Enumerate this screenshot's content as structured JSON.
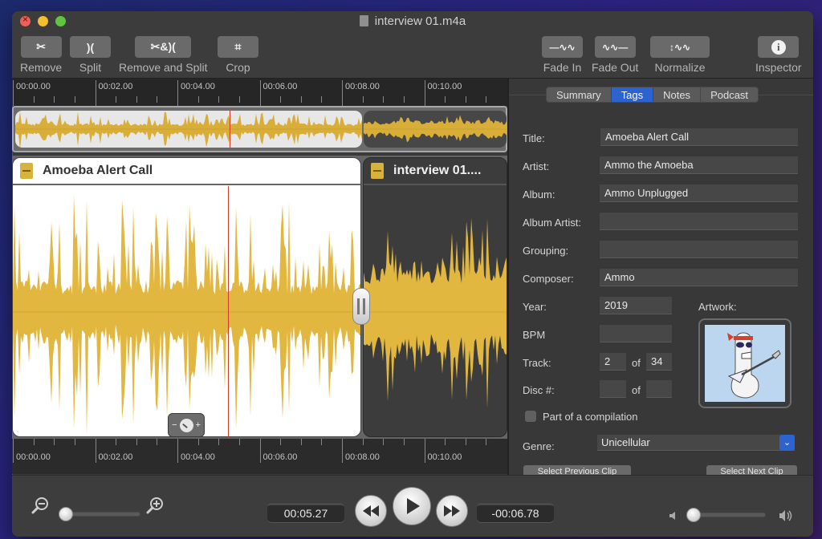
{
  "window": {
    "title": "interview 01.m4a"
  },
  "toolbar": {
    "left": [
      {
        "id": "remove",
        "label": "Remove",
        "icon": "scissors-icon",
        "glyph": "✂"
      },
      {
        "id": "split",
        "label": "Split",
        "icon": "split-icon",
        "glyph": ")("
      },
      {
        "id": "remove-and-split",
        "label": "Remove and Split",
        "icon": "remove-and-split-icon",
        "glyph": "✂&)("
      },
      {
        "id": "crop",
        "label": "Crop",
        "icon": "crop-icon",
        "glyph": "⌗"
      }
    ],
    "right": [
      {
        "id": "fade-in",
        "label": "Fade In",
        "icon": "fade-in-icon",
        "glyph": "—∿∿"
      },
      {
        "id": "fade-out",
        "label": "Fade Out",
        "icon": "fade-out-icon",
        "glyph": "∿∿—"
      },
      {
        "id": "normalize",
        "label": "Normalize",
        "icon": "normalize-icon",
        "glyph": "↕∿∿"
      },
      {
        "id": "inspector",
        "label": "Inspector",
        "icon": "info-icon",
        "glyph": "i"
      }
    ]
  },
  "timeline": {
    "tick_labels": [
      "00:00.00",
      "00:02.00",
      "00:04.00",
      "00:06.00",
      "00:08.00",
      "00:10.00"
    ],
    "playhead_time": "00:04.87",
    "clips": [
      {
        "title": "Amoeba Alert Call",
        "selected": true
      },
      {
        "title": "interview 01....",
        "selected": false
      }
    ]
  },
  "inspector": {
    "tabs": [
      {
        "label": "Summary",
        "active": false
      },
      {
        "label": "Tags",
        "active": true
      },
      {
        "label": "Notes",
        "active": false
      },
      {
        "label": "Podcast",
        "active": false
      }
    ],
    "fields": {
      "title": {
        "label": "Title:",
        "value": "Amoeba Alert Call"
      },
      "artist": {
        "label": "Artist:",
        "value": "Ammo the Amoeba"
      },
      "album": {
        "label": "Album:",
        "value": "Ammo Unplugged"
      },
      "album_artist": {
        "label": "Album Artist:",
        "value": ""
      },
      "grouping": {
        "label": "Grouping:",
        "value": ""
      },
      "composer": {
        "label": "Composer:",
        "value": "Ammo"
      },
      "year": {
        "label": "Year:",
        "value": "2019"
      },
      "bpm": {
        "label": "BPM",
        "value": ""
      },
      "track": {
        "label": "Track:",
        "value": "2",
        "of_label": "of",
        "total": "34"
      },
      "disc": {
        "label": "Disc #:",
        "value": "",
        "of_label": "of",
        "total": ""
      }
    },
    "artwork_label": "Artwork:",
    "compilation": {
      "label": "Part of a compilation",
      "checked": false
    },
    "genre": {
      "label": "Genre:",
      "value": "Unicellular"
    },
    "prev_clip_label": "Select Previous Clip",
    "next_clip_label": "Select Next Clip"
  },
  "transport": {
    "elapsed": "00:05.27",
    "remaining": "-00:06.78",
    "zoom_level": 0.0,
    "volume_level": 0.0
  }
}
